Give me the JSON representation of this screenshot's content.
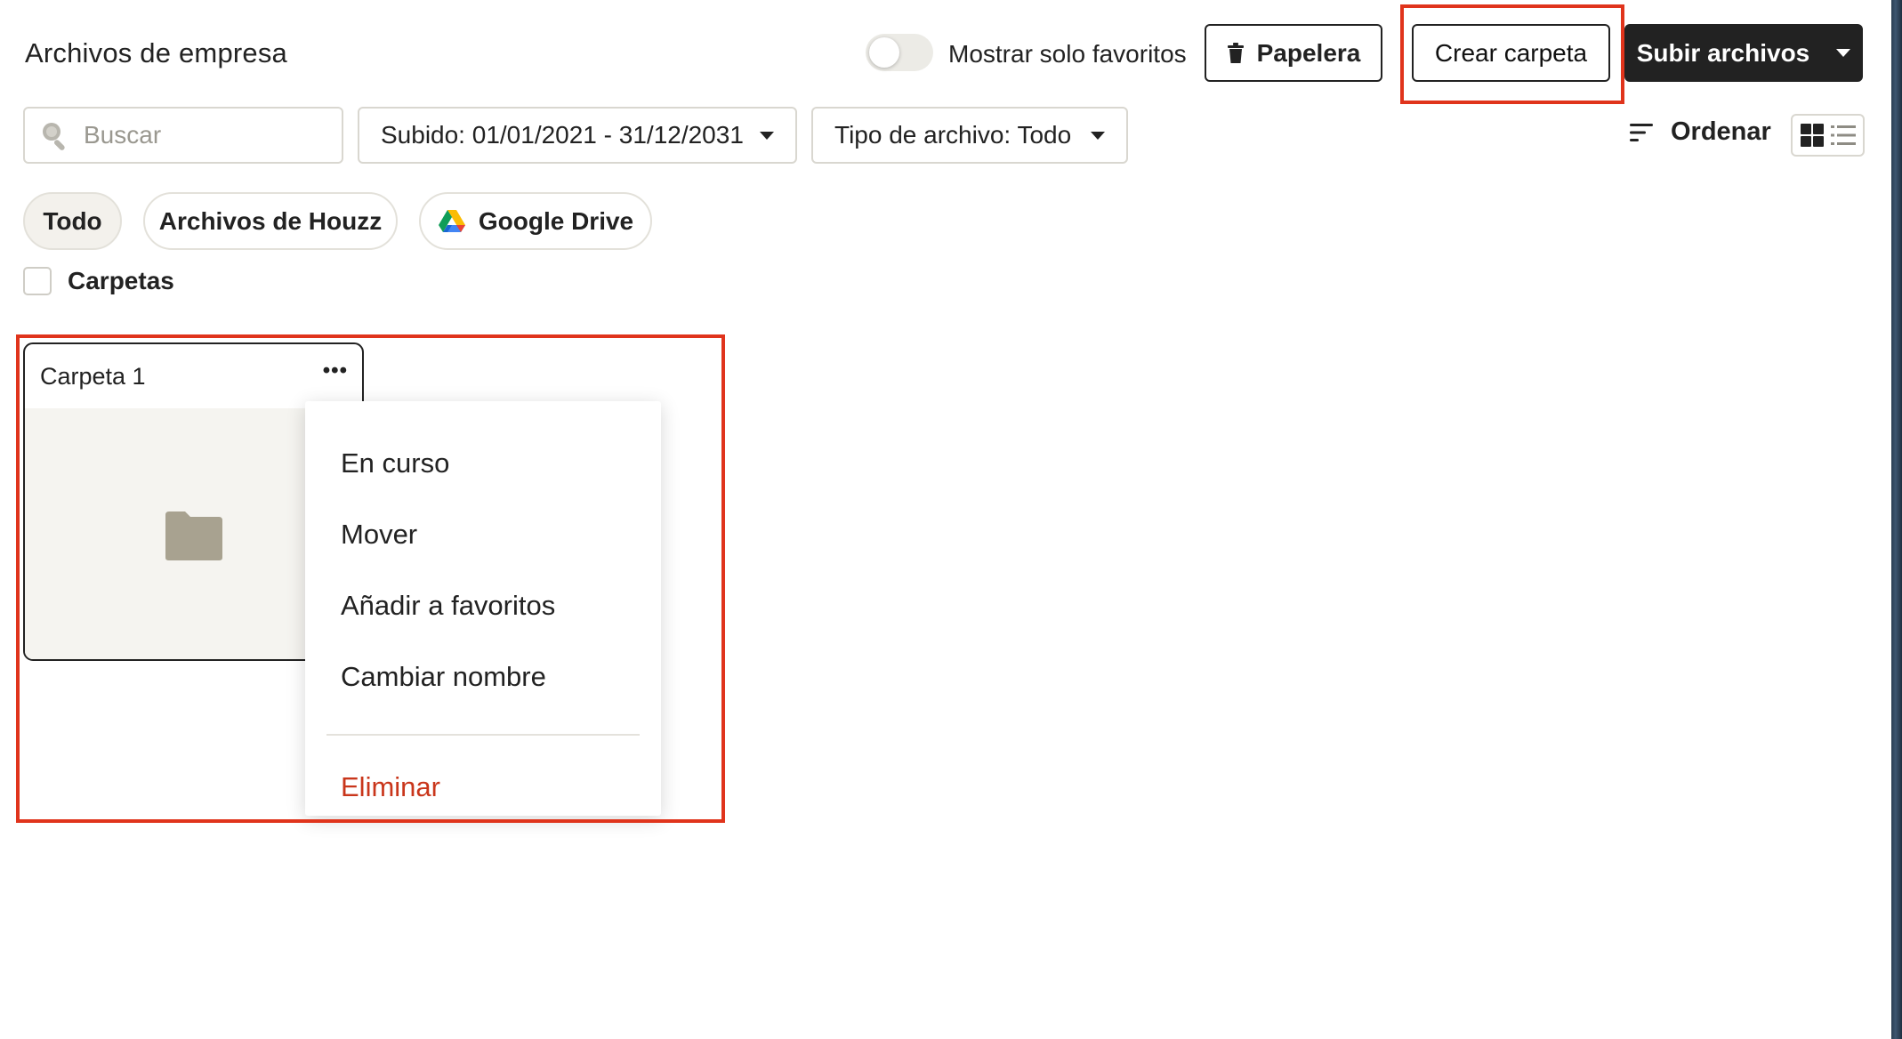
{
  "header": {
    "title": "Archivos de empresa",
    "favorites_toggle_label": "Mostrar solo favoritos",
    "favorites_toggle_on": false,
    "trash_button": "Papelera",
    "create_folder_button": "Crear carpeta",
    "upload_button": "Subir archivos"
  },
  "filters": {
    "search_placeholder": "Buscar",
    "upload_date": "Subido: 01/01/2021 - 31/12/2031",
    "file_type": "Tipo de archivo: Todo",
    "sort_label": "Ordenar"
  },
  "sources": [
    {
      "label": "Todo"
    },
    {
      "label": "Archivos de Houzz"
    },
    {
      "label": "Google Drive"
    }
  ],
  "folders_filter": {
    "label": "Carpetas",
    "checked": false
  },
  "folder_card": {
    "title": "Carpeta 1"
  },
  "context_menu": {
    "items": [
      {
        "label": "En curso"
      },
      {
        "label": "Mover"
      },
      {
        "label": "Añadir a favoritos"
      },
      {
        "label": "Cambiar nombre"
      }
    ],
    "danger_item": "Eliminar"
  },
  "colors": {
    "highlight": "#e0341c",
    "primary_button": "#222222",
    "danger": "#c9361b",
    "folder_icon": "#a8a290"
  }
}
